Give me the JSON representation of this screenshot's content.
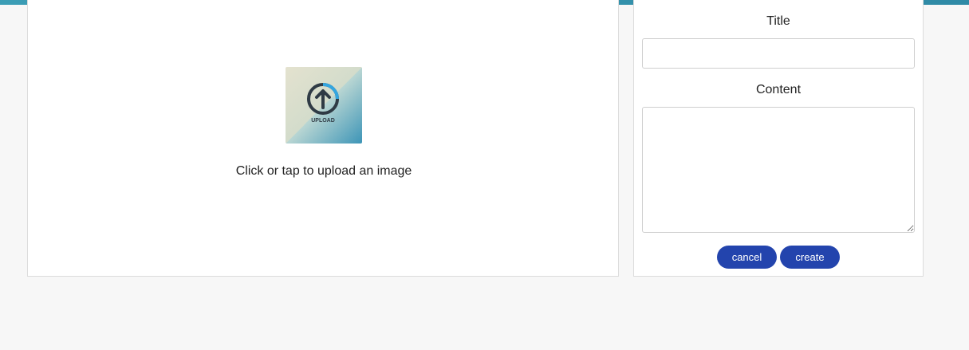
{
  "upload": {
    "thumb_label": "UPLOAD",
    "hint": "Click or tap to upload an image",
    "icon": "upload-arrow-icon"
  },
  "form": {
    "title_label": "Title",
    "title_value": "",
    "content_label": "Content",
    "content_value": "",
    "cancel_label": "cancel",
    "create_label": "create"
  },
  "colors": {
    "top_bar": "#3b9db5",
    "button": "#2344ad",
    "background": "#f7f7f7"
  }
}
